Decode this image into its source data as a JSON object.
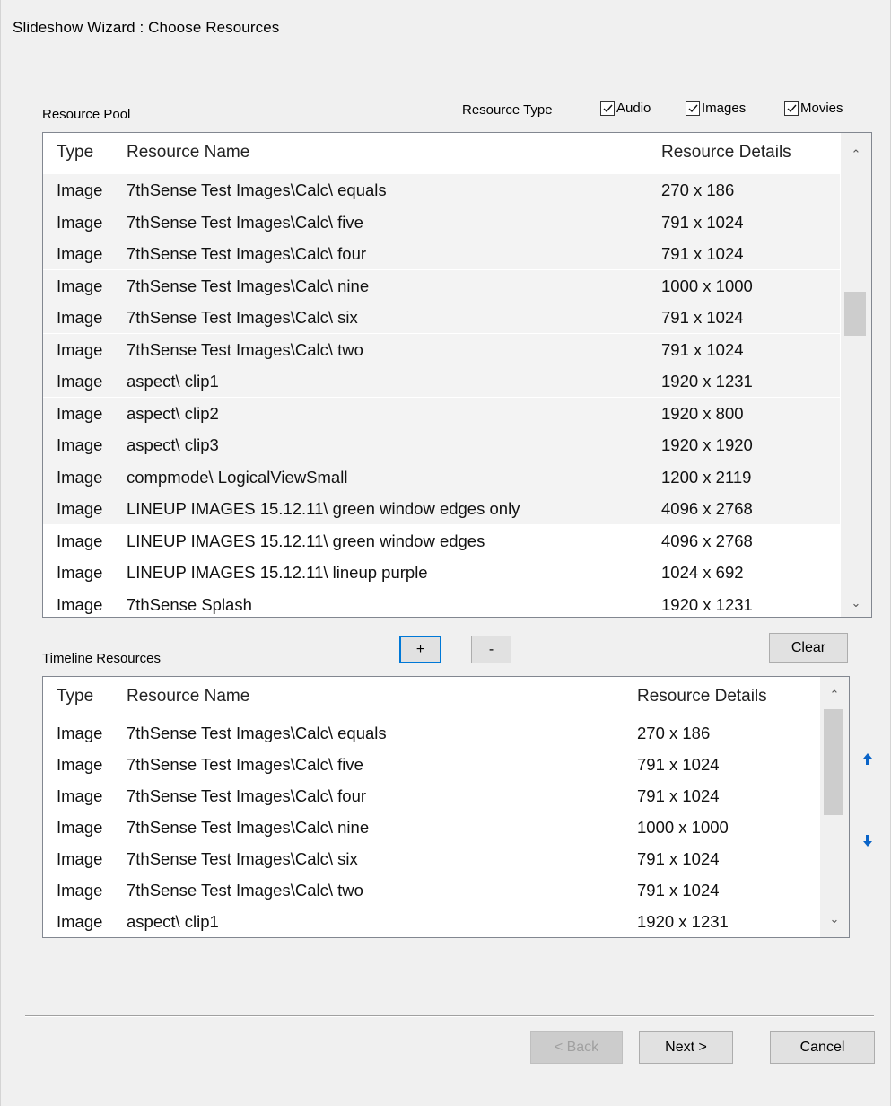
{
  "window": {
    "title": "Slideshow Wizard : Choose Resources"
  },
  "resource_pool": {
    "label": "Resource Pool",
    "type_filter": {
      "label": "Resource Type",
      "options": [
        {
          "label": "Audio",
          "checked": true
        },
        {
          "label": "Images",
          "checked": true
        },
        {
          "label": "Movies",
          "checked": true
        }
      ]
    },
    "columns": [
      "Type",
      "Resource Name",
      "Resource Details"
    ],
    "rows": [
      {
        "type": "Image",
        "name": "7thSense Test Images\\Calc\\ equals",
        "details": "270 x 186",
        "selected": true
      },
      {
        "type": "Image",
        "name": "7thSense Test Images\\Calc\\ five",
        "details": "791 x 1024",
        "selected": true
      },
      {
        "type": "Image",
        "name": "7thSense Test Images\\Calc\\ four",
        "details": "791 x 1024",
        "selected": true
      },
      {
        "type": "Image",
        "name": "7thSense Test Images\\Calc\\ nine",
        "details": "1000 x 1000",
        "selected": true
      },
      {
        "type": "Image",
        "name": "7thSense Test Images\\Calc\\ six",
        "details": "791 x 1024",
        "selected": true
      },
      {
        "type": "Image",
        "name": "7thSense Test Images\\Calc\\ two",
        "details": "791 x 1024",
        "selected": true
      },
      {
        "type": "Image",
        "name": "aspect\\ clip1",
        "details": "1920 x 1231",
        "selected": true
      },
      {
        "type": "Image",
        "name": "aspect\\ clip2",
        "details": "1920 x 800",
        "selected": true
      },
      {
        "type": "Image",
        "name": "aspect\\ clip3",
        "details": "1920 x 1920",
        "selected": true
      },
      {
        "type": "Image",
        "name": "compmode\\ LogicalViewSmall",
        "details": "1200 x 2119",
        "selected": true
      },
      {
        "type": "Image",
        "name": "LINEUP IMAGES 15.12.11\\ green window edges only",
        "details": "4096 x 2768",
        "selected": true
      },
      {
        "type": "Image",
        "name": "LINEUP IMAGES 15.12.11\\ green window edges",
        "details": "4096 x 2768",
        "selected": false
      },
      {
        "type": "Image",
        "name": "LINEUP IMAGES 15.12.11\\ lineup purple",
        "details": "1024 x 692",
        "selected": false
      },
      {
        "type": "Image",
        "name": " 7thSense Splash",
        "details": "1920 x 1231",
        "selected": false
      }
    ]
  },
  "controls": {
    "add_label": "+",
    "remove_label": "-",
    "clear_label": "Clear"
  },
  "timeline": {
    "label": "Timeline Resources",
    "columns": [
      "Type",
      "Resource Name",
      "Resource Details"
    ],
    "rows": [
      {
        "type": "Image",
        "name": "7thSense Test Images\\Calc\\ equals",
        "details": "270 x 186"
      },
      {
        "type": "Image",
        "name": "7thSense Test Images\\Calc\\ five",
        "details": "791 x 1024"
      },
      {
        "type": "Image",
        "name": "7thSense Test Images\\Calc\\ four",
        "details": "791 x 1024"
      },
      {
        "type": "Image",
        "name": "7thSense Test Images\\Calc\\ nine",
        "details": "1000 x 1000"
      },
      {
        "type": "Image",
        "name": "7thSense Test Images\\Calc\\ six",
        "details": "791 x 1024"
      },
      {
        "type": "Image",
        "name": "7thSense Test Images\\Calc\\ two",
        "details": "791 x 1024"
      },
      {
        "type": "Image",
        "name": "aspect\\ clip1",
        "details": "1920 x 1231"
      }
    ]
  },
  "footer": {
    "back_label": "< Back",
    "next_label": "Next >",
    "cancel_label": "Cancel"
  },
  "colors": {
    "accent": "#0078d7",
    "window_bg": "#f0f0f0",
    "selection_bg": "#f3f3f3",
    "scroll_thumb": "#cdcdcd"
  }
}
